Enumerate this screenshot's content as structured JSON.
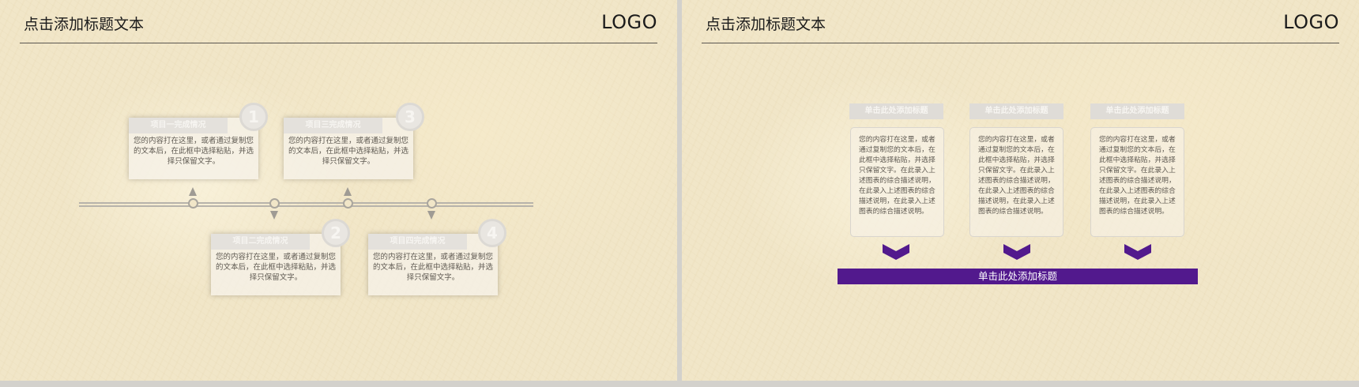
{
  "slide_left": {
    "title": "点击添加标题文本",
    "logo": "LOGO",
    "items": [
      {
        "num": "1",
        "heading": "项目一完成情况",
        "body": "您的内容打在这里，或者通过复制您的文本后，在此框中选择粘贴，并选择只保留文字。"
      },
      {
        "num": "2",
        "heading": "项目二完成情况",
        "body": "您的内容打在这里，或者通过复制您的文本后，在此框中选择粘贴，并选择只保留文字。"
      },
      {
        "num": "3",
        "heading": "项目三完成情况",
        "body": "您的内容打在这里，或者通过复制您的文本后，在此框中选择粘贴，并选择只保留文字。"
      },
      {
        "num": "4",
        "heading": "项目四完成情况",
        "body": "您的内容打在这里，或者通过复制您的文本后，在此框中选择粘贴，并选择只保留文字。"
      }
    ]
  },
  "slide_right": {
    "title": "点击添加标题文本",
    "logo": "LOGO",
    "columns": [
      {
        "tag": "单击此处添加标题",
        "body": "您的内容打在这里，或者通过复制您的文本后，在此框中选择粘贴，并选择只保留文字。在此录入上述图表的综合描述说明，在此录入上述图表的综合描述说明，在此录入上述图表的综合描述说明。"
      },
      {
        "tag": "单击此处添加标题",
        "body": "您的内容打在这里，或者通过复制您的文本后，在此框中选择粘贴，并选择只保留文字。在此录入上述图表的综合描述说明，在此录入上述图表的综合描述说明，在此录入上述图表的综合描述说明。"
      },
      {
        "tag": "单击此处添加标题",
        "body": "您的内容打在这里，或者通过复制您的文本后，在此框中选择粘贴，并选择只保留文字。在此录入上述图表的综合描述说明，在此录入上述图表的综合描述说明，在此录入上述图表的综合描述说明。"
      }
    ],
    "bar_label": "单击此处添加标题"
  },
  "colors": {
    "accent": "#52198d",
    "paper": "#f1e6c8",
    "card_head": "#e4e1dc"
  },
  "icons": [
    "chevron-down-icon"
  ]
}
